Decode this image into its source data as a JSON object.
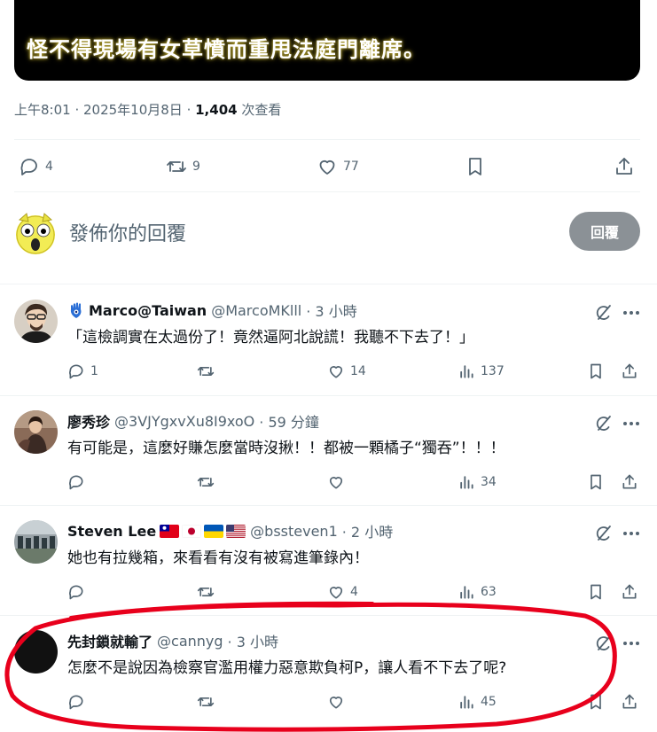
{
  "video": {
    "subtitle": "怪不得現場有女草憤而重甩法庭門離席。"
  },
  "post_meta": {
    "time": "上午8:01",
    "date": "2025年10月8日",
    "views_count": "1,404",
    "views_label": "次查看"
  },
  "post_actions": {
    "replies": "4",
    "reposts": "9",
    "likes": "77"
  },
  "compose": {
    "placeholder": "發佈你的回覆",
    "button_label": "回覆"
  },
  "replies": [
    {
      "name": "Marco@Taiwan",
      "handle": "@MarcoMKlll",
      "time": "· 3 小時",
      "text": "「這檢調實在太過份了！竟然逼阿北說謊！我聽不下去了！」",
      "reply_count": "1",
      "repost_count": "",
      "like_count": "14",
      "view_count": "137"
    },
    {
      "name": "廖秀珍",
      "handle": "@3VJYgxvXu8I9xoO",
      "time": "· 59 分鐘",
      "text": "有可能是，這麼好賺怎麼當時沒揪！！都被一顆橘子“獨吞”！！！",
      "reply_count": "",
      "repost_count": "",
      "like_count": "",
      "view_count": "34"
    },
    {
      "name": "Steven Lee",
      "handle": "@bssteven1",
      "time": "· 2 小時",
      "text": "她也有拉幾箱，來看看有沒有被寫進筆錄內！",
      "reply_count": "",
      "repost_count": "",
      "like_count": "4",
      "view_count": "63"
    },
    {
      "name": "先封鎖就輸了",
      "handle": "@cannyg",
      "time": "· 3 小時",
      "text": "怎麼不是說因為檢察官濫用權力惡意欺負柯P，讓人看不下去了呢?",
      "reply_count": "",
      "repost_count": "",
      "like_count": "",
      "view_count": "45"
    }
  ],
  "colors": {
    "text": "#0f1419",
    "muted": "#536471",
    "divider": "#eff3f4",
    "reply_button": "#8b9196",
    "highlight": "#e8001c"
  }
}
